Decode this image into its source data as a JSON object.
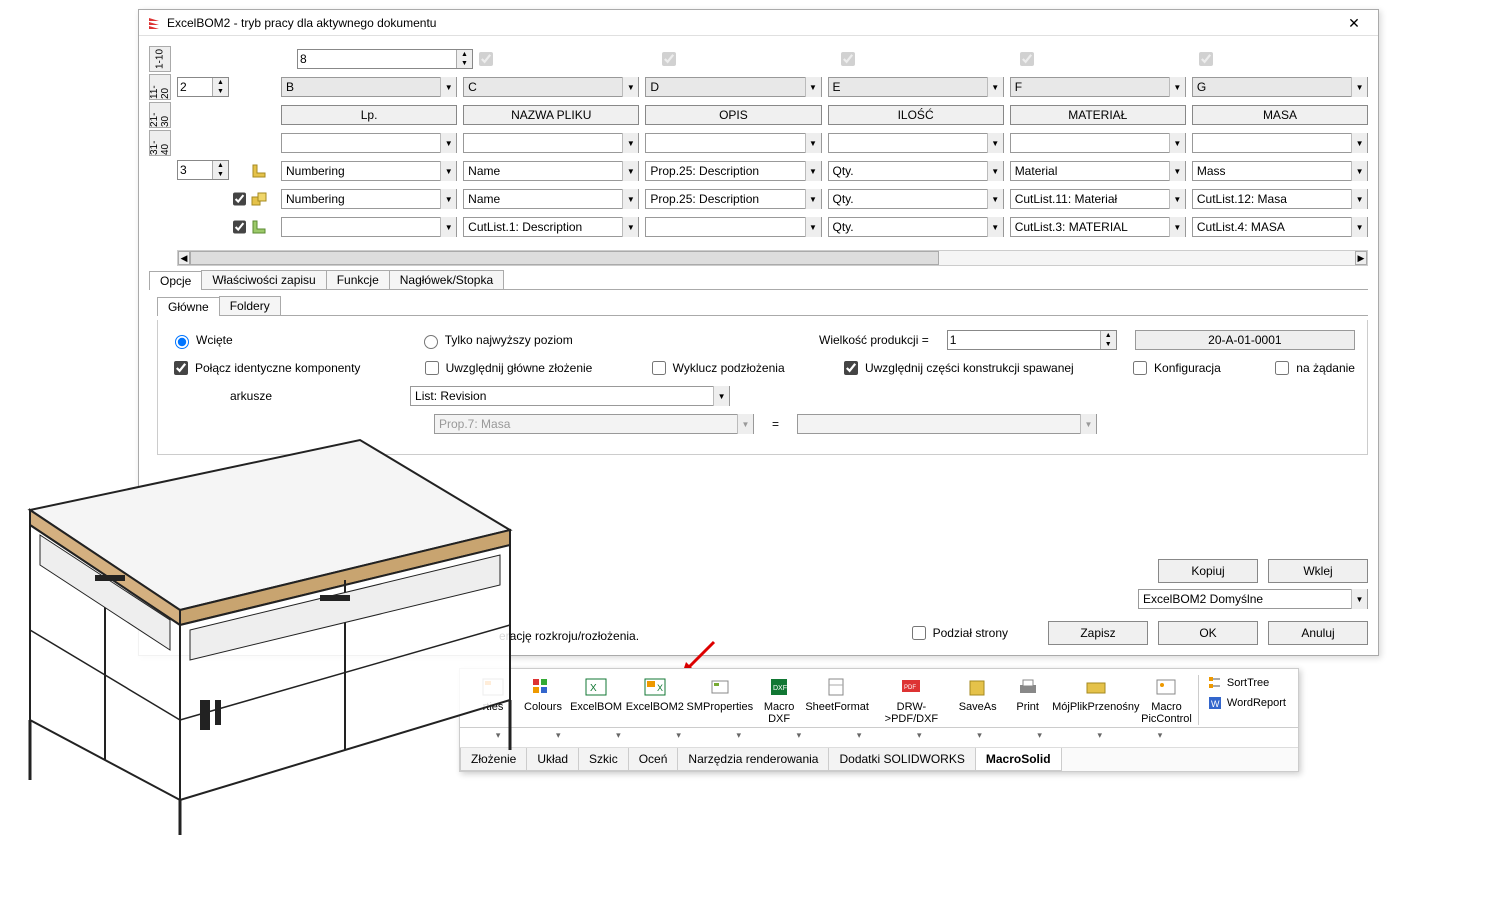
{
  "title": "ExcelBOM2 - tryb pracy dla aktywnego dokumentu",
  "vtabs": [
    "1-10",
    "11-20",
    "21-30",
    "31-40"
  ],
  "spinners": {
    "top": "8",
    "a2": "2",
    "a3": "3"
  },
  "letter_row": [
    "B",
    "C",
    "D",
    "E",
    "F",
    "G"
  ],
  "header_buttons": [
    "Lp.",
    "NAZWA PLIKU",
    "OPIS",
    "ILOŚĆ",
    "MATERIAŁ",
    "MASA"
  ],
  "row4": [
    "Numbering",
    "Name",
    "Prop.25: Description",
    "Qty.",
    "Material",
    "Mass"
  ],
  "row5": [
    "Numbering",
    "Name",
    "Prop.25: Description",
    "Qty.",
    "CutList.11: Materiał",
    "CutList.12: Masa"
  ],
  "row6": [
    "",
    "CutList.1: Description",
    "",
    "Qty.",
    "CutList.3: MATERIAL",
    "CutList.4: MASA"
  ],
  "tabs": [
    "Opcje",
    "Właściwości zapisu",
    "Funkcje",
    "Nagłówek/Stopka"
  ],
  "subtabs": [
    "Główne",
    "Foldery"
  ],
  "options": {
    "wciete": "Wcięte",
    "tylko": "Tylko najwyższy poziom",
    "wielkosc_lbl": "Wielkość produkcji =",
    "wielkosc_val": "1",
    "code": "20-A-01-0001",
    "polacz": "Połącz identyczne komponenty",
    "uwzglednij_glowne": "Uwzględnij główne złożenie",
    "wyklucz": "Wyklucz podzłożenia",
    "uwzglednij_spaw": "Uwzględnij części konstrukcji spawanej",
    "konfig": "Konfiguracja",
    "na_zadanie": "na żądanie",
    "arkusze": "arkusze",
    "list_revision": "List: Revision",
    "prop7": "Prop.7: Masa",
    "eq": "="
  },
  "buttons": {
    "kopiuj": "Kopiuj",
    "wklej": "Wklej",
    "profile": "ExcelBOM2 Domyślne",
    "zapisz": "Zapisz",
    "ok": "OK",
    "anuluj": "Anuluj",
    "podzial": "Podział strony"
  },
  "msg": "erację rozkroju/rozłożenia.",
  "ribbon": {
    "items": [
      "rties",
      "Colours",
      "ExcelBOM",
      "ExcelBOM2",
      "SMProperties",
      "Macro\nDXF",
      "SheetFormat",
      "DRW->PDF/DXF",
      "SaveAs",
      "Print",
      "MójPlikPrzenośny",
      "Macro\nPicControl"
    ],
    "side": [
      "SortTree",
      "WordReport"
    ],
    "tabs": [
      "Złożenie",
      "Układ",
      "Szkic",
      "Oceń",
      "Narzędzia renderowania",
      "Dodatki SOLIDWORKS",
      "MacroSolid"
    ]
  }
}
